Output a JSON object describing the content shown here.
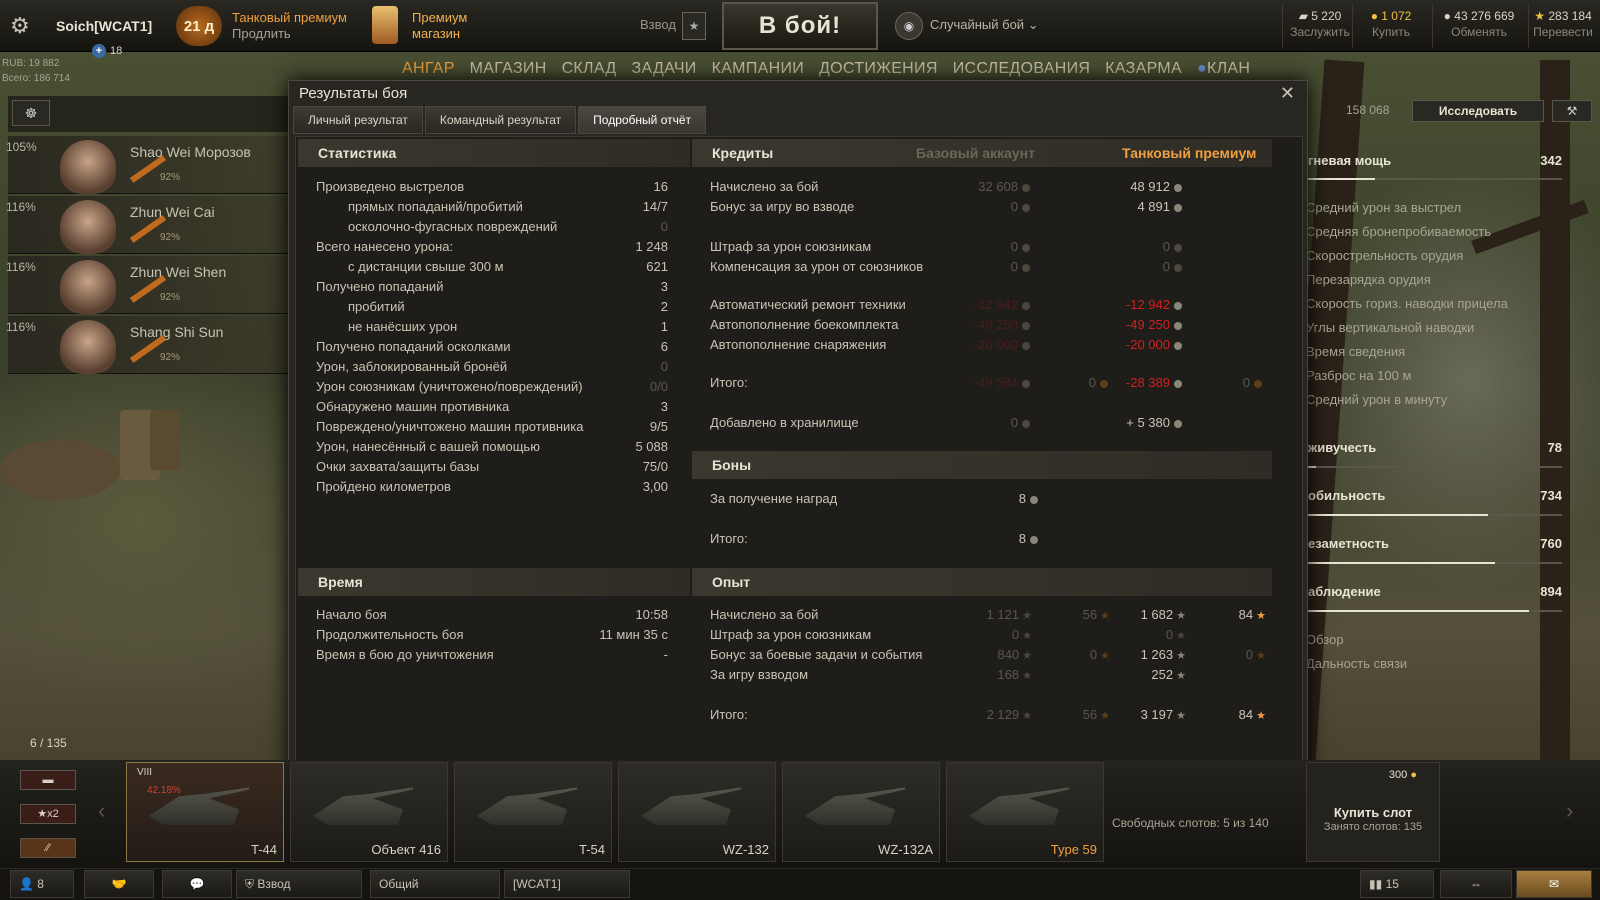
{
  "topbar": {
    "user": "Soich[WCAT1]",
    "premium_days": "21 д",
    "premium_title": "Танковый премиум",
    "premium_sub": "Продлить",
    "shop_title": "Премиум",
    "shop_sub": "магазин",
    "platoon_label": "Взвод",
    "battle_label": "В бой!",
    "mode_label": "Случайный бой",
    "currencies": [
      {
        "value": "5 220",
        "label": "Заслужить"
      },
      {
        "value": "1 072",
        "label": "Купить"
      },
      {
        "value": "43 276 669",
        "label": "Обменять"
      },
      {
        "value": "283 184",
        "label": "Перевести"
      }
    ]
  },
  "left_info": {
    "rub": "RUB: 19 882",
    "total": "Всего: 186 714",
    "xp_badge": "18"
  },
  "menu": [
    "АНГАР",
    "МАГАЗИН",
    "СКЛАД",
    "ЗАДАЧИ",
    "КАМПАНИИ",
    "ДОСТИЖЕНИЯ",
    "ИССЛЕДОВАНИЯ",
    "КАЗАРМА",
    "КЛАН"
  ],
  "crew": [
    {
      "pct": "105%",
      "name": "Shao Wei Морозов",
      "skill": "92%"
    },
    {
      "pct": "116%",
      "name": "Zhun Wei Cai",
      "skill": "92%"
    },
    {
      "pct": "116%",
      "name": "Zhun Wei Shen",
      "skill": "92%"
    },
    {
      "pct": "116%",
      "name": "Shang Shi Sun",
      "skill": "92%"
    }
  ],
  "right_panel": {
    "score": "158 068",
    "research_btn": "Исследовать",
    "firepower": {
      "label": "гневая мощь",
      "value": "342",
      "level": 0.27
    },
    "firepower_items": [
      "Средний урон за выстрел",
      "Средняя бронепробиваемость",
      "Скорострельность орудия",
      "Перезарядка орудия",
      "Скорость гориз. наводки прицела",
      "Углы вертикальной наводки",
      "Время сведения",
      "Разброс на 100 м",
      "Средний урон в минуту"
    ],
    "survivability": {
      "label": "живучесть",
      "value": "78",
      "level": 0.04
    },
    "mobility": {
      "label": "обильность",
      "value": "734",
      "level": 0.71
    },
    "stealth": {
      "label": "езаметность",
      "value": "760",
      "level": 0.74
    },
    "spotting": {
      "label": "аблюдение",
      "value": "894",
      "level": 0.87
    },
    "spotting_items": [
      "Обзор",
      "Дальность связи"
    ]
  },
  "modal": {
    "title": "Результаты боя",
    "tabs": [
      "Личный результат",
      "Командный результат",
      "Подробный отчёт"
    ],
    "stats": {
      "title": "Статистика",
      "rows": [
        {
          "label": "Произведено выстрелов",
          "value": "16",
          "indent": false,
          "dim": false
        },
        {
          "label": "прямых попаданий/пробитий",
          "value": "14/7",
          "indent": true,
          "dim": false
        },
        {
          "label": "осколочно-фугасных повреждений",
          "value": "0",
          "indent": true,
          "dim": true
        },
        {
          "label": "Всего нанесено урона:",
          "value": "1 248",
          "indent": false,
          "dim": false
        },
        {
          "label": "с дистанции свыше 300 м",
          "value": "621",
          "indent": true,
          "dim": false
        },
        {
          "label": "Получено попаданий",
          "value": "3",
          "indent": false,
          "dim": false
        },
        {
          "label": "пробитий",
          "value": "2",
          "indent": true,
          "dim": false
        },
        {
          "label": "не нанёсших урон",
          "value": "1",
          "indent": true,
          "dim": false
        },
        {
          "label": "Получено попаданий осколками",
          "value": "6",
          "indent": false,
          "dim": false
        },
        {
          "label": "Урон, заблокированный бронёй",
          "value": "0",
          "indent": false,
          "dim": true
        },
        {
          "label": "Урон союзникам (уничтожено/повреждений)",
          "value": "0/0",
          "indent": false,
          "dim": true
        },
        {
          "label": "Обнаружено машин противника",
          "value": "3",
          "indent": false,
          "dim": false
        },
        {
          "label": "Повреждено/уничтожено машин противника",
          "value": "9/5",
          "indent": false,
          "dim": false
        },
        {
          "label": "Урон, нанесённый с вашей помощью",
          "value": "5 088",
          "indent": false,
          "dim": false
        },
        {
          "label": "Очки захвата/защиты базы",
          "value": "75/0",
          "indent": false,
          "dim": false
        },
        {
          "label": "Пройдено километров",
          "value": "3,00",
          "indent": false,
          "dim": false
        }
      ]
    },
    "time": {
      "title": "Время",
      "rows": [
        {
          "label": "Начало боя",
          "value": "10:58"
        },
        {
          "label": "Продолжительность боя",
          "value": "11 мин 35 с"
        },
        {
          "label": "Время в бою до уничтожения",
          "value": "-"
        }
      ]
    },
    "credits": {
      "title": "Кредиты",
      "col_base": "Базовый аккаунт",
      "col_prem": "Танковый премиум",
      "rows": [
        {
          "label": "Начислено за бой",
          "base": "32 608",
          "prem": "48 912"
        },
        {
          "label": "Бонус за игру во взводе",
          "base": "0",
          "prem": "4 891"
        },
        {
          "label": "Штраф за урон союзникам",
          "base": "0",
          "prem": "0"
        },
        {
          "label": "Компенсация за урон от союзников",
          "base": "0",
          "prem": "0"
        },
        {
          "label": "Автоматический ремонт техники",
          "base": "-12 942",
          "prem": "-12 942"
        },
        {
          "label": "Автопополнение боекомплекта",
          "base": "-49 250",
          "prem": "-49 250"
        },
        {
          "label": "Автопополнение снаряжения",
          "base": "-20 000",
          "prem": "-20 000"
        },
        {
          "label": "Итого:",
          "base": "-49 584",
          "base_gold": "0",
          "prem": "-28 389",
          "prem_gold": "0"
        },
        {
          "label": "Добавлено в хранилище",
          "base": "0",
          "prem": "+ 5 380"
        }
      ]
    },
    "bonds": {
      "title": "Боны",
      "rows": [
        {
          "label": "За получение наград",
          "value": "8"
        },
        {
          "label": "Итого:",
          "value": "8"
        }
      ]
    },
    "xp": {
      "title": "Опыт",
      "rows": [
        {
          "label": "Начислено за бой",
          "base": "1 121",
          "base_free": "56",
          "prem": "1 682",
          "prem_free": "84"
        },
        {
          "label": "Штраф за урон союзникам",
          "base": "0",
          "base_free": "",
          "prem": "0",
          "prem_free": ""
        },
        {
          "label": "Бонус за боевые задачи и события",
          "base": "840",
          "base_free": "0",
          "prem": "1 263",
          "prem_free": "0"
        },
        {
          "label": "За игру взводом",
          "base": "168",
          "base_free": "",
          "prem": "252",
          "prem_free": ""
        },
        {
          "label": "Итого:",
          "base": "2 129",
          "base_free": "56",
          "prem": "3 197",
          "prem_free": "84"
        }
      ]
    }
  },
  "garage": {
    "counter": "6 / 135",
    "x2": "x2",
    "tanks": [
      {
        "name": "T-44",
        "tier": "VIII",
        "pct": "42.18%",
        "gold": false
      },
      {
        "name": "Объект 416",
        "gold": false
      },
      {
        "name": "T-54",
        "gold": false
      },
      {
        "name": "WZ-132",
        "gold": false
      },
      {
        "name": "WZ-132A",
        "gold": false
      },
      {
        "name": "Type 59",
        "gold": true
      }
    ],
    "free_slots": "Свободных слотов: 5 из 140",
    "buy_slot_title": "Купить слот",
    "buy_slot_sub": "Занято слотов: 135",
    "buy_slot_price": "300"
  },
  "bottombar": {
    "friends": "8",
    "platoon": "Взвод",
    "general": "Общий",
    "clan": "[WCAT1]",
    "count": "15"
  }
}
